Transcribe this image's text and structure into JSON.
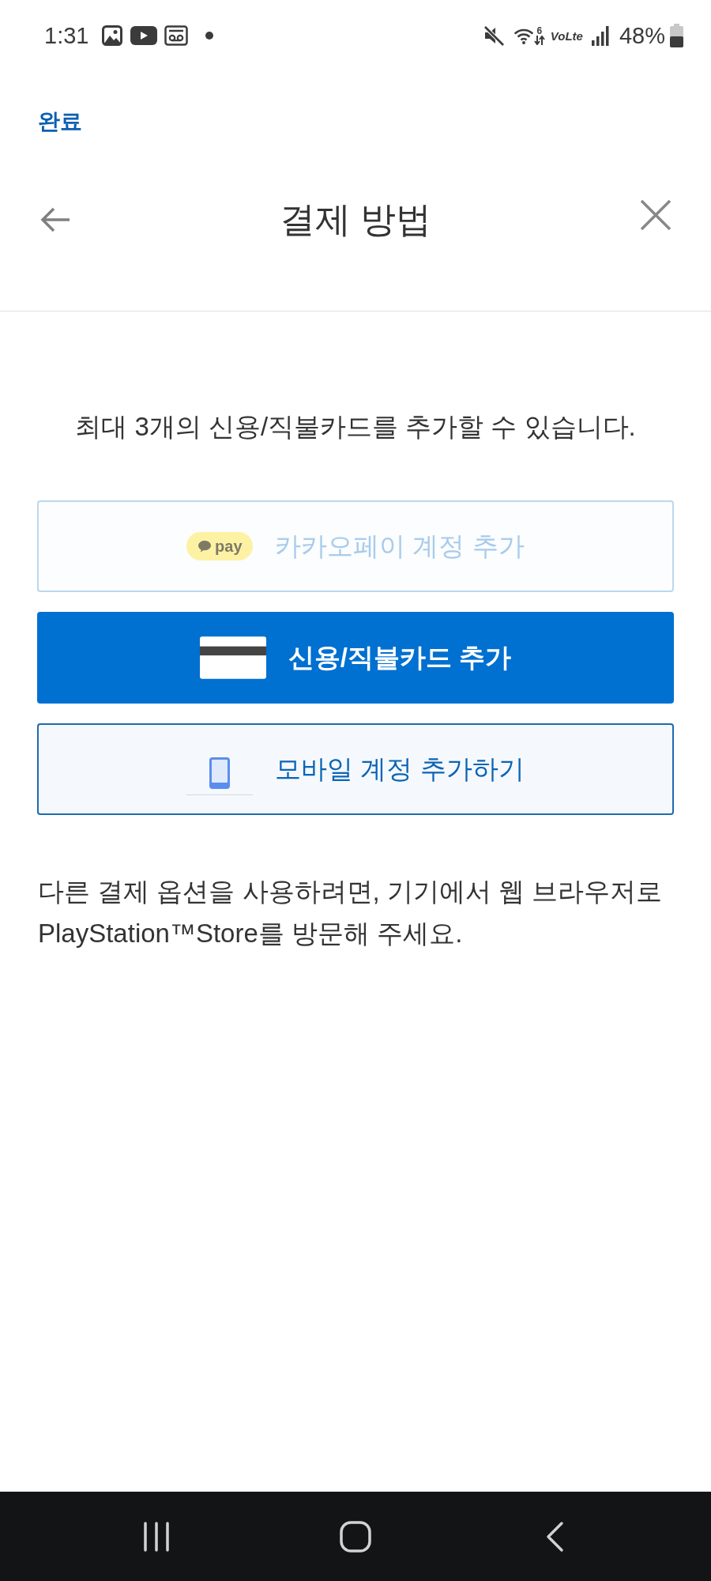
{
  "status_bar": {
    "time": "1:31",
    "wifi_generation": "6",
    "volte": "VoLte",
    "battery": "48%"
  },
  "top_action": {
    "label": "완료"
  },
  "header": {
    "title": "결제 방법"
  },
  "info": "최대 3개의 신용/직불카드를 추가할 수 있습니다.",
  "payment_options": [
    {
      "kind": "kakaopay",
      "badge": "pay",
      "label": "카카오페이 계정 추가",
      "disabled": true
    },
    {
      "kind": "card",
      "label": "신용/직불카드 추가",
      "disabled": false
    },
    {
      "kind": "mobile",
      "label": "모바일 계정 추가하기",
      "disabled": false
    }
  ],
  "note": "다른 결제 옵션을 사용하려면, 기기에서 웹 브라우저로 PlayStation™Store를 방문해 주세요."
}
